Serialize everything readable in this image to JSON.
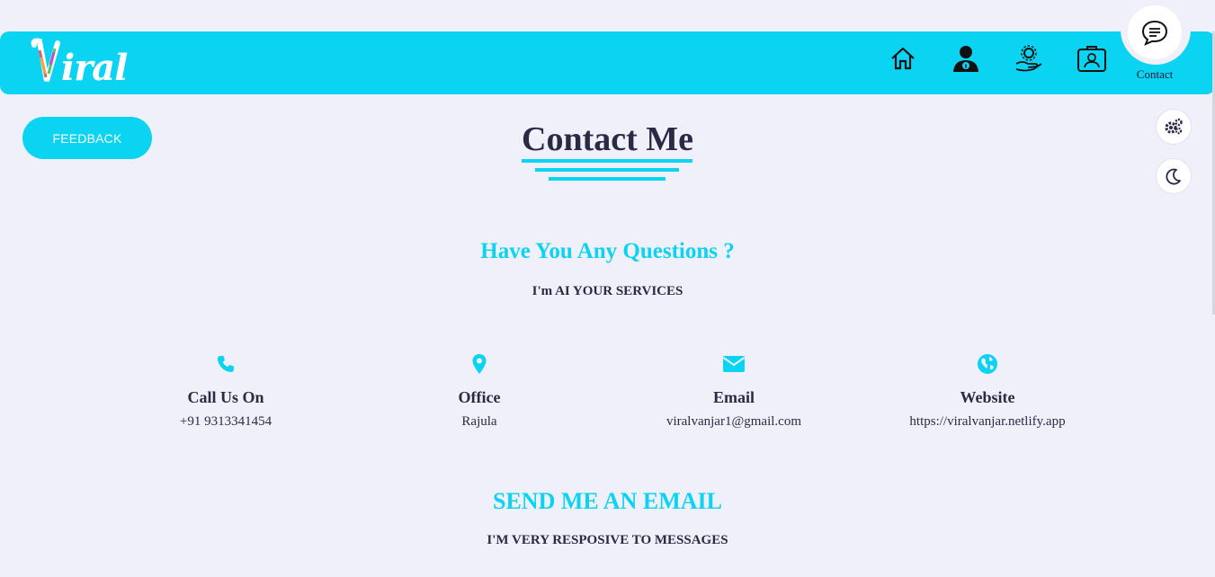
{
  "header": {
    "logo_text": "iral",
    "contact_label": "Contact",
    "nav_icons": [
      "home-icon",
      "about-icon",
      "services-icon",
      "portfolio-icon"
    ]
  },
  "feedback_label": "FEEDBACK",
  "title": "Contact Me",
  "questions": {
    "heading": "Have You Any Questions ?",
    "sub": "I'm AI YOUR SERVICES"
  },
  "info": [
    {
      "icon": "phone-icon",
      "title": "Call Us On",
      "value": "+91 9313341454"
    },
    {
      "icon": "location-pin-icon",
      "title": "Office",
      "value": "Rajula"
    },
    {
      "icon": "envelope-icon",
      "title": "Email",
      "value": "viralvanjar1@gmail.com"
    },
    {
      "icon": "globe-icon",
      "title": "Website",
      "value": "https://viralvanjar.netlify.app"
    }
  ],
  "email_section": {
    "heading": "SEND ME AN EMAIL",
    "sub": "I'M VERY RESPOSIVE TO MESSAGES"
  },
  "colors": {
    "accent": "#0ad4f2",
    "background": "#f0f0fa",
    "text": "#2a2a45"
  }
}
